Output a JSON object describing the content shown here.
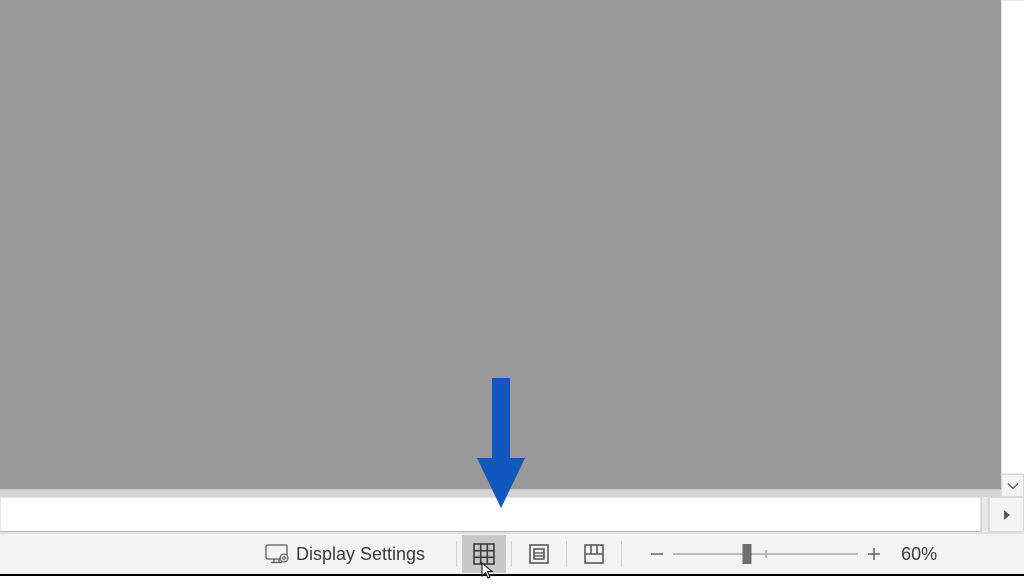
{
  "status_bar": {
    "display_settings_label": "Display Settings",
    "zoom_value": "60%"
  },
  "arrow_color": "#1257be"
}
